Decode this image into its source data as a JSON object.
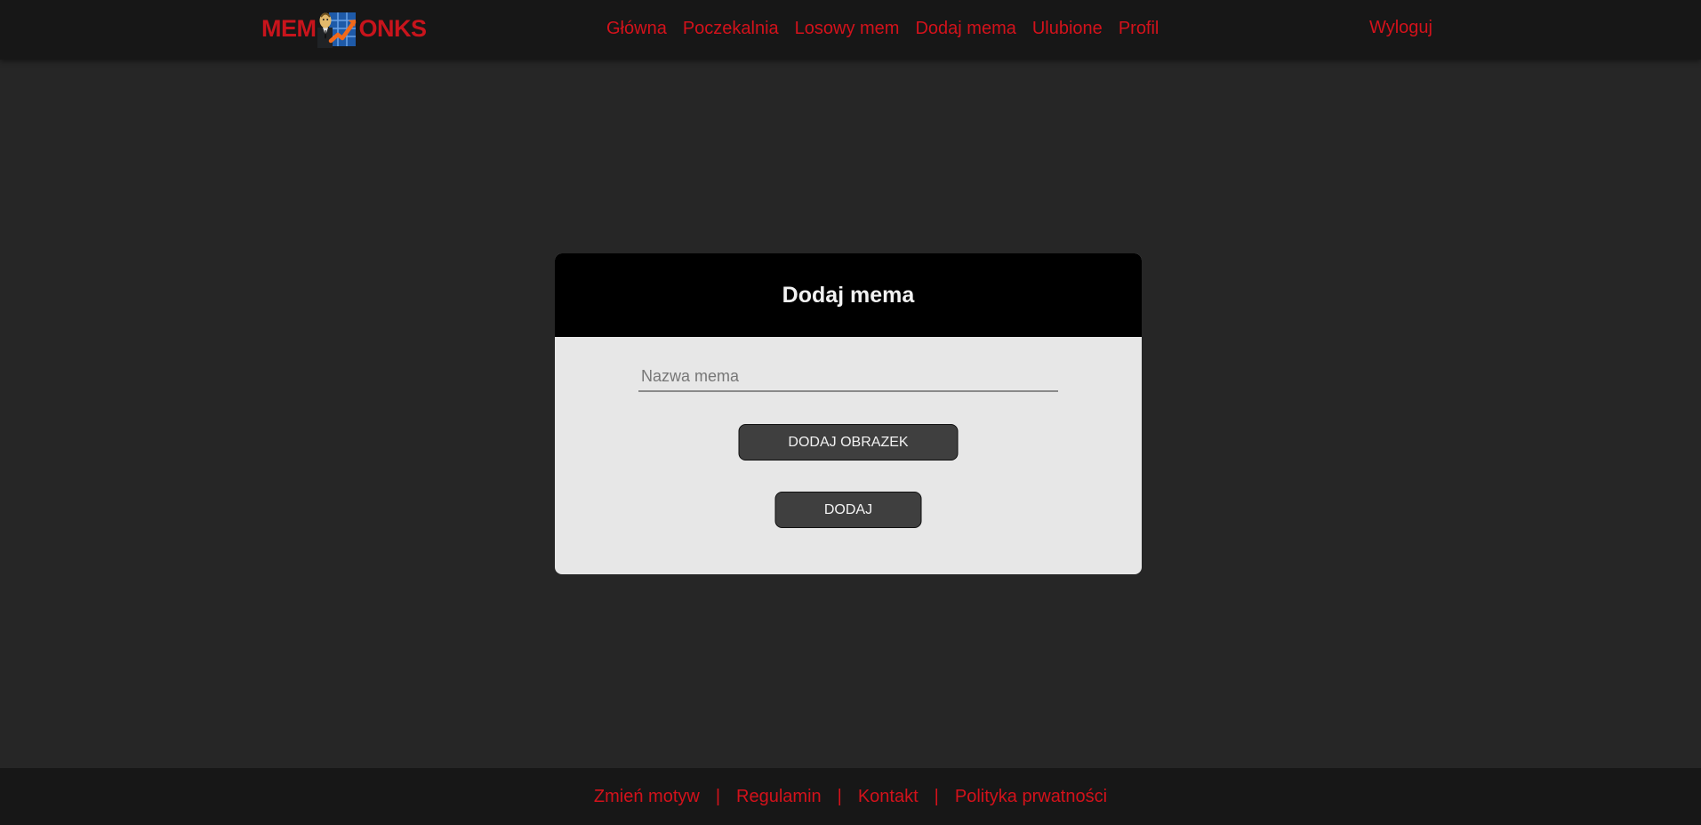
{
  "header": {
    "logo": {
      "text_left": "MEM",
      "text_right": "ONKS"
    },
    "nav": [
      {
        "label": "Główna"
      },
      {
        "label": "Poczekalnia"
      },
      {
        "label": "Losowy mem"
      },
      {
        "label": "Dodaj mema"
      },
      {
        "label": "Ulubione"
      },
      {
        "label": "Profil"
      }
    ],
    "logout_label": "Wyloguj"
  },
  "form": {
    "title": "Dodaj mema",
    "name_field": {
      "placeholder": "Nazwa mema",
      "value": ""
    },
    "add_image_label": "DODAJ OBRAZEK",
    "submit_label": "DODAJ"
  },
  "footer": {
    "links": [
      {
        "label": "Zmień motyw"
      },
      {
        "label": "Regulamin"
      },
      {
        "label": "Kontakt"
      },
      {
        "label": "Polityka prwatności"
      }
    ],
    "separator": "|"
  },
  "colors": {
    "accent": "#d3121b",
    "background": "#262626",
    "bar": "#171717",
    "card_header": "#000000",
    "card_body": "#e7e7e7",
    "button": "#3f3f3f"
  },
  "icons": {
    "logo_emblem": "stonks-man-chart-icon"
  }
}
